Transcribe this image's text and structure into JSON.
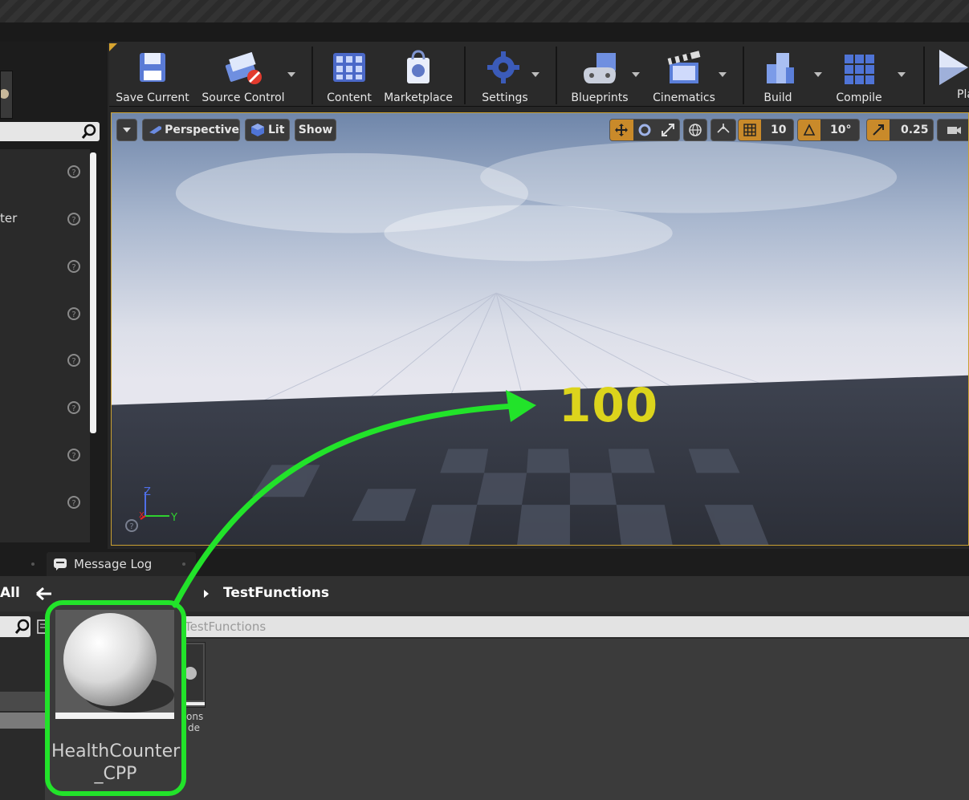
{
  "toolbar": {
    "items": [
      {
        "label": "Save Current",
        "icon": "save-icon"
      },
      {
        "label": "Source Control",
        "icon": "source-control-icon"
      },
      {
        "label": "Content",
        "icon": "content-icon"
      },
      {
        "label": "Marketplace",
        "icon": "marketplace-icon"
      },
      {
        "label": "Settings",
        "icon": "settings-icon"
      },
      {
        "label": "Blueprints",
        "icon": "blueprints-icon"
      },
      {
        "label": "Cinematics",
        "icon": "cinematics-icon"
      },
      {
        "label": "Build",
        "icon": "build-icon"
      },
      {
        "label": "Compile",
        "icon": "compile-icon"
      },
      {
        "label": "Play",
        "icon": "play-icon"
      }
    ]
  },
  "left_panel": {
    "partial_label": "ter"
  },
  "viewport": {
    "view_mode": "Perspective",
    "lighting": "Lit",
    "show": "Show",
    "grid_snap": "10",
    "rotation_snap": "10°",
    "scale_snap": "0.25",
    "scene_text": "100",
    "axis_z": "Z",
    "axis_x": "X",
    "axis_y": "Y"
  },
  "tabs": {
    "message_log": "Message Log"
  },
  "content_browser": {
    "filter_all": "All",
    "breadcrumb": "TestFunctions",
    "path": "TestFunctions",
    "asset_name_line1": "HealthCounter",
    "asset_name_line2": "_CPP",
    "partial_asset_line1": "ons",
    "partial_asset_line2": "de"
  },
  "colors": {
    "highlight_green": "#22e32a",
    "viewport_border": "#c9a032",
    "counter_yellow": "#dcd41c"
  }
}
